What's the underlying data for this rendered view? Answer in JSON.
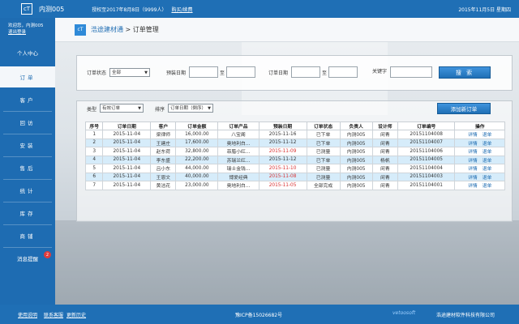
{
  "topbar": {
    "logo": "cT",
    "title": "内测005",
    "license": "授权至2017年8月8日（9999人）",
    "renew": "购买/续费",
    "date": "2015年11月5日 星期四"
  },
  "sidebar": {
    "welcome": "欢迎您，内测005",
    "logout": "退出登录",
    "items": [
      {
        "label": "个人中心"
      },
      {
        "label": "订单"
      },
      {
        "label": "客户"
      },
      {
        "label": "回访"
      },
      {
        "label": "安装"
      },
      {
        "label": "售后"
      },
      {
        "label": "统计"
      },
      {
        "label": "库存"
      },
      {
        "label": "商铺"
      },
      {
        "label": "消息提醒",
        "badge": "2"
      }
    ]
  },
  "header": {
    "icon": "cT",
    "brand": "浩途建材通",
    "sep": " > ",
    "page": "订单管理"
  },
  "search": {
    "status_label": "订单状态",
    "status_value": "全部",
    "preorder_label": "预装日期",
    "to1": "至",
    "orderdate_label": "订单日期",
    "to2": "至",
    "keyword_label": "关键字",
    "search_button": "搜 索"
  },
  "list": {
    "type_label": "类型",
    "type_value": "有效订单",
    "sort_label": "排序",
    "sort_value": "订单日期（倒序）",
    "add_button": "添加新订单",
    "columns": [
      "序号",
      "订单日期",
      "客户",
      "订单金额",
      "订单产品",
      "预装日期",
      "订单状态",
      "负责人",
      "设计师",
      "订单编号",
      "操作"
    ],
    "rows": [
      {
        "no": "1",
        "date": "2015-11-04",
        "customer": "梁律师",
        "amount": "16,000.00",
        "product": "八宝阁",
        "pre": "2015-11-16",
        "pre_red": false,
        "status": "已下单",
        "owner": "内测005",
        "designer": "闵青",
        "code": "20151104008"
      },
      {
        "no": "2",
        "date": "2015-11-04",
        "customer": "王建庄",
        "amount": "17,600.00",
        "product": "奥地利白...",
        "pre": "2015-11-12",
        "pre_red": false,
        "status": "已下单",
        "owner": "内测005",
        "designer": "闵青",
        "code": "20151104007"
      },
      {
        "no": "3",
        "date": "2015-11-04",
        "customer": "赵东荷",
        "amount": "32,800.00",
        "product": "菲腊小红...",
        "pre": "2015-11-09",
        "pre_red": true,
        "status": "已测量",
        "owner": "内测005",
        "designer": "闵青",
        "code": "20151104006"
      },
      {
        "no": "4",
        "date": "2015-11-04",
        "customer": "李东盛",
        "amount": "22,200.00",
        "product": "苏瑞兰红...",
        "pre": "2015-11-12",
        "pre_red": false,
        "status": "已下单",
        "owner": "内测005",
        "designer": "杨帆",
        "code": "20151104005"
      },
      {
        "no": "5",
        "date": "2015-11-04",
        "customer": "吕小东",
        "amount": "44,000.00",
        "product": "瑞士金钱...",
        "pre": "2015-11-10",
        "pre_red": true,
        "status": "已测量",
        "owner": "内测005",
        "designer": "闵青",
        "code": "20151104004"
      },
      {
        "no": "6",
        "date": "2015-11-04",
        "customer": "王恩文",
        "amount": "40,000.00",
        "product": "博爱经典",
        "pre": "2015-11-08",
        "pre_red": true,
        "status": "已测量",
        "owner": "内测005",
        "designer": "闵青",
        "code": "20151104003"
      },
      {
        "no": "7",
        "date": "2015-11-04",
        "customer": "黄洁花",
        "amount": "23,000.00",
        "product": "奥地利白...",
        "pre": "2015-11-05",
        "pre_red": true,
        "status": "全部完成",
        "owner": "内测005",
        "designer": "闵青",
        "code": "20151104001"
      }
    ],
    "op_detail": "详情",
    "op_refund": "退单"
  },
  "footer": {
    "links": [
      "使用说明",
      "联系客服",
      "更新历史"
    ],
    "icp": "豫ICP备15026682号",
    "vendor": "vetoosoft",
    "company": "浩途建材软件科技有限公司"
  }
}
